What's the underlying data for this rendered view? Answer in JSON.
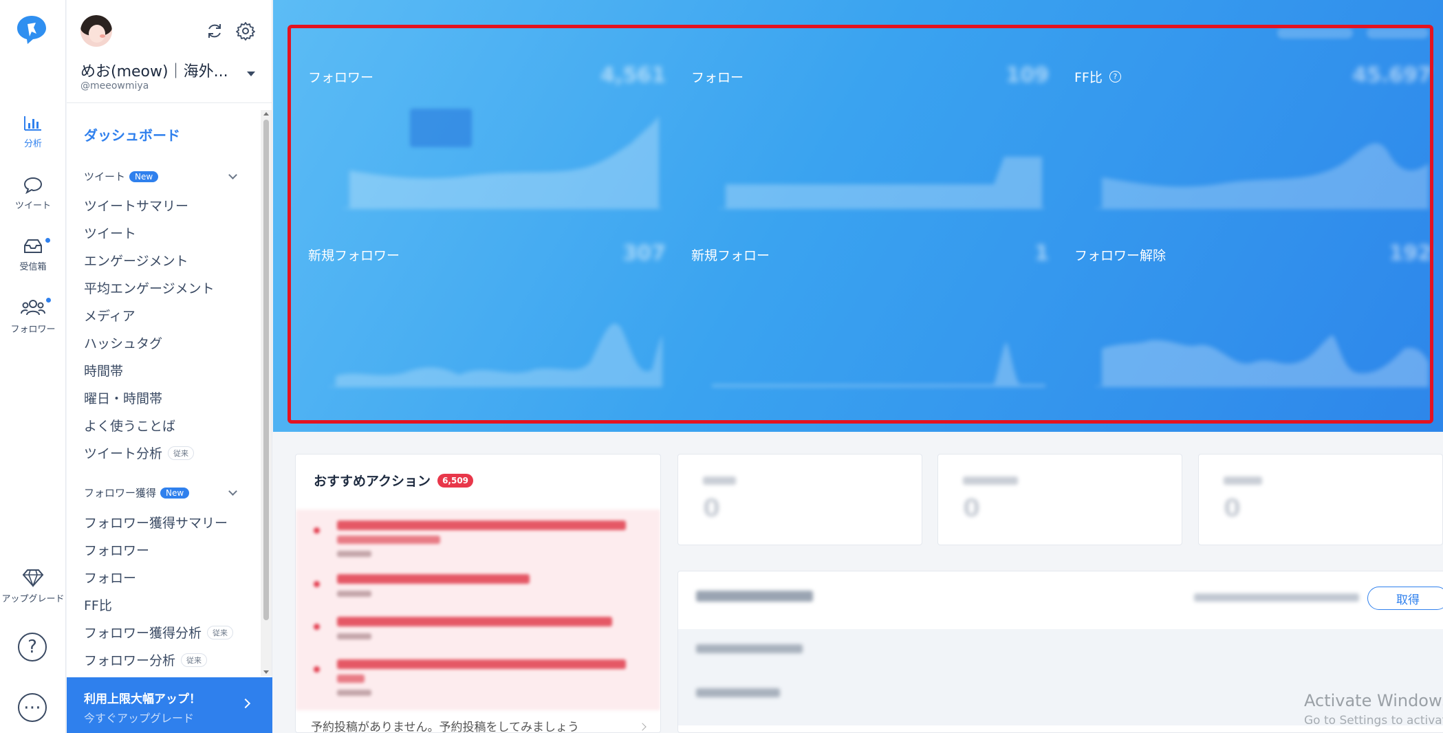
{
  "rail": {
    "nav": [
      {
        "label": "分析",
        "icon": "bar-chart-icon",
        "active": true
      },
      {
        "label": "ツイート",
        "icon": "speech-bubble-icon",
        "active": false
      },
      {
        "label": "受信箱",
        "icon": "inbox-icon",
        "active": false,
        "has_dot": true
      },
      {
        "label": "フォロワー",
        "icon": "users-icon",
        "active": false,
        "has_dot": true
      }
    ],
    "upgrade_label": "アップグレード",
    "help_glyph": "?",
    "more_glyph": "⋯"
  },
  "profile": {
    "name": "めお(meow)｜海外...",
    "handle": "@meeowmiya"
  },
  "menu": {
    "dashboard": "ダッシュボード",
    "sections": [
      {
        "title": "ツイート",
        "badge": "New",
        "items": [
          {
            "label": "ツイートサマリー"
          },
          {
            "label": "ツイート"
          },
          {
            "label": "エンゲージメント"
          },
          {
            "label": "平均エンゲージメント"
          },
          {
            "label": "メディア"
          },
          {
            "label": "ハッシュタグ"
          },
          {
            "label": "時間帯"
          },
          {
            "label": "曜日・時間帯"
          },
          {
            "label": "よく使うことば"
          },
          {
            "label": "ツイート分析",
            "tag": "従来"
          }
        ]
      },
      {
        "title": "フォロワー獲得",
        "badge": "New",
        "items": [
          {
            "label": "フォロワー獲得サマリー"
          },
          {
            "label": "フォロワー"
          },
          {
            "label": "フォロー"
          },
          {
            "label": "FF比"
          },
          {
            "label": "フォロワー獲得分析",
            "tag": "従来"
          },
          {
            "label": "フォロワー分析",
            "tag": "従来"
          }
        ]
      }
    ]
  },
  "upgrade_banner": {
    "title": "利用上限大幅アップ！",
    "subtitle": "今すぐアップグレード"
  },
  "panels": [
    {
      "title": "フォロワー",
      "value": "4,561",
      "help": false
    },
    {
      "title": "フォロー",
      "value": "109",
      "help": false
    },
    {
      "title": "FF比",
      "value": "45.697",
      "help": true
    },
    {
      "title": "新規フォロワー",
      "value": "307",
      "help": false
    },
    {
      "title": "新規フォロー",
      "value": "1",
      "help": false
    },
    {
      "title": "フォロワー解除",
      "value": "192",
      "help": false
    }
  ],
  "recommended": {
    "title": "おすすめアクション",
    "count": "6,509",
    "schedule_note": "予約投稿がありません。予約投稿をしてみましょう"
  },
  "stats": [
    {
      "value": "0"
    },
    {
      "value": "0"
    },
    {
      "value": "0"
    }
  ],
  "retweet_card": {
    "button": "取得"
  },
  "watermark": {
    "line1": "Activate Windows",
    "line2": "Go to Settings to activate"
  },
  "colors": {
    "accent": "#2f80ed",
    "highlight_frame": "#e4121f",
    "badge_red": "#e8374a"
  }
}
